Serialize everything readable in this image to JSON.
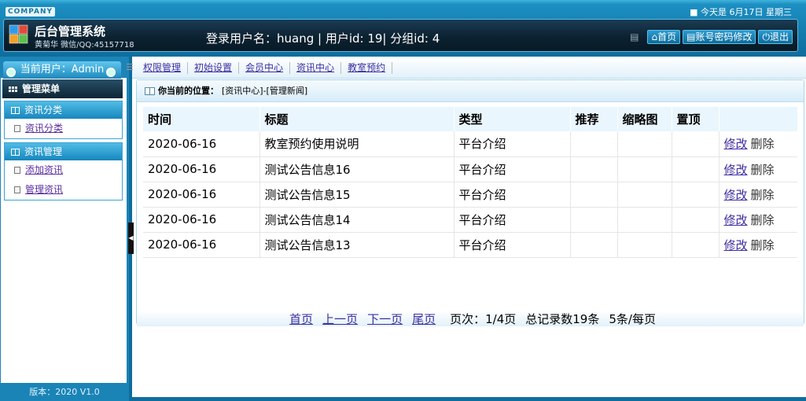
{
  "header": {
    "company": "COMPANY",
    "date_text": "今天是 6月17日 星期三",
    "title": "后台管理系统",
    "subtitle": "黄菊华 微信/QQ:45157718",
    "login_info": "登录用户名：huang | 用户id: 19| 分组id: 4",
    "buttons": [
      {
        "label": "首页",
        "icon": "home-icon"
      },
      {
        "label": "账号密码修改",
        "icon": "document-icon"
      },
      {
        "label": "退出",
        "icon": "power-icon"
      }
    ]
  },
  "sidebar": {
    "current_user": "当前用户：Admin",
    "menu_title": "管理菜单",
    "groups": [
      {
        "title": "资讯分类",
        "items": [
          "资讯分类"
        ]
      },
      {
        "title": "资讯管理",
        "items": [
          "添加资讯",
          "管理资讯"
        ]
      }
    ],
    "version": "版本：2020 V1.0"
  },
  "topnav": {
    "tabs": [
      "权限管理",
      "初始设置",
      "会员中心",
      "资讯中心",
      "教室预约"
    ]
  },
  "breadcrumb": {
    "label": "你当前的位置：",
    "path": "[资讯中心]-[管理新闻]"
  },
  "table": {
    "headers": [
      "时间",
      "标题",
      "类型",
      "推荐",
      "缩略图",
      "置顶",
      ""
    ],
    "rows": [
      {
        "time": "2020-06-16",
        "title": "教室预约使用说明",
        "type": "平台介绍",
        "recommend": "",
        "thumb": "",
        "top": "",
        "edit": "修改",
        "del": "删除"
      },
      {
        "time": "2020-06-16",
        "title": "测试公告信息16",
        "type": "平台介绍",
        "recommend": "",
        "thumb": "",
        "top": "",
        "edit": "修改",
        "del": "删除"
      },
      {
        "time": "2020-06-16",
        "title": "测试公告信息15",
        "type": "平台介绍",
        "recommend": "",
        "thumb": "",
        "top": "",
        "edit": "修改",
        "del": "删除"
      },
      {
        "time": "2020-06-16",
        "title": "测试公告信息14",
        "type": "平台介绍",
        "recommend": "",
        "thumb": "",
        "top": "",
        "edit": "修改",
        "del": "删除"
      },
      {
        "time": "2020-06-16",
        "title": "测试公告信息13",
        "type": "平台介绍",
        "recommend": "",
        "thumb": "",
        "top": "",
        "edit": "修改",
        "del": "删除"
      }
    ]
  },
  "pager": {
    "first": "首页",
    "prev": "上一页",
    "next": "下一页",
    "last": "尾页",
    "page_info": "页次：1/4页",
    "total_info": "总记录数19条",
    "per_page": "5条/每页"
  }
}
